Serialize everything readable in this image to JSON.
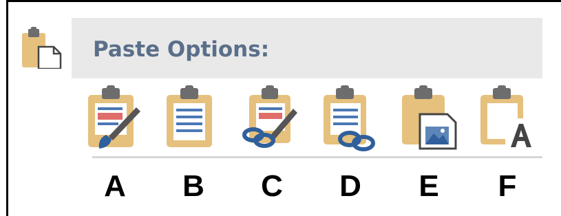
{
  "header": {
    "title": "Paste Options:",
    "icon": "clipboard-paste-icon"
  },
  "options": [
    {
      "letter": "A",
      "icon": "paste-keep-source-formatting-icon"
    },
    {
      "letter": "B",
      "icon": "paste-plain-document-icon"
    },
    {
      "letter": "C",
      "icon": "paste-link-keep-source-formatting-icon"
    },
    {
      "letter": "D",
      "icon": "paste-link-icon"
    },
    {
      "letter": "E",
      "icon": "paste-picture-icon"
    },
    {
      "letter": "F",
      "icon": "paste-text-only-icon"
    }
  ],
  "colors": {
    "clipboard": "#e6c07d",
    "clip": "#6d6d6d",
    "lines": "#4a78b5",
    "title_text": "#5a6f89",
    "header_bg": "#e9e9e9",
    "divider": "#d6d6d6",
    "letters": "#000000"
  }
}
